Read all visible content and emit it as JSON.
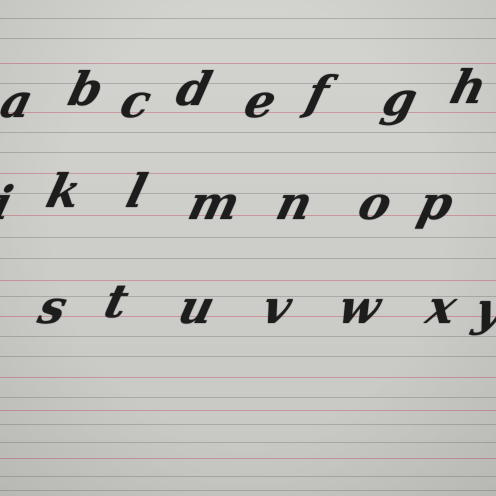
{
  "rows": [
    {
      "letters": [
        "a",
        "b",
        "c",
        "d",
        "e",
        "f",
        "g",
        "h"
      ]
    },
    {
      "letters": [
        "i",
        "k",
        "l",
        "m",
        "n",
        "o",
        "p"
      ]
    },
    {
      "letters": [
        "s",
        "t",
        "u",
        "v",
        "w",
        "x",
        "y"
      ]
    }
  ]
}
